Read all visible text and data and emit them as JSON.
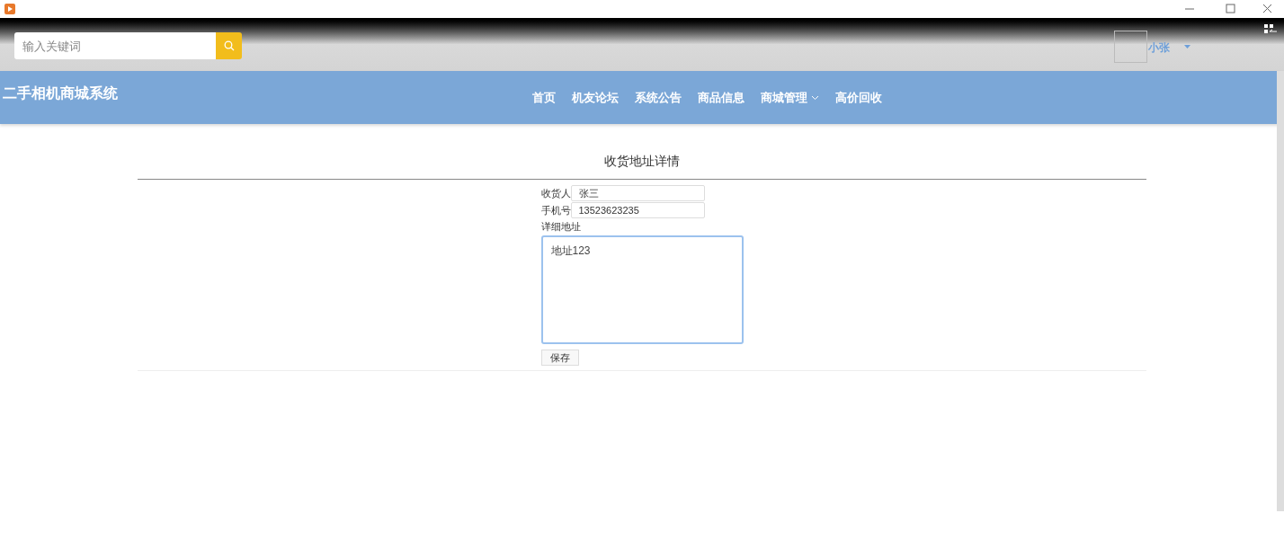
{
  "search": {
    "placeholder": "输入关键词"
  },
  "user": {
    "name": "小张"
  },
  "site": {
    "title": "二手相机商城系统"
  },
  "nav": [
    {
      "label": "首页",
      "dropdown": false
    },
    {
      "label": "机友论坛",
      "dropdown": false
    },
    {
      "label": "系统公告",
      "dropdown": false
    },
    {
      "label": "商品信息",
      "dropdown": false
    },
    {
      "label": "商城管理",
      "dropdown": true
    },
    {
      "label": "高价回收",
      "dropdown": false
    }
  ],
  "page": {
    "title": "收货地址详情"
  },
  "form": {
    "fields": [
      {
        "label": "收货人",
        "value": "张三"
      },
      {
        "label": "手机号",
        "value": "13523623235"
      }
    ],
    "address": {
      "label": "详细地址",
      "value": "地址123"
    },
    "save": "保存"
  }
}
